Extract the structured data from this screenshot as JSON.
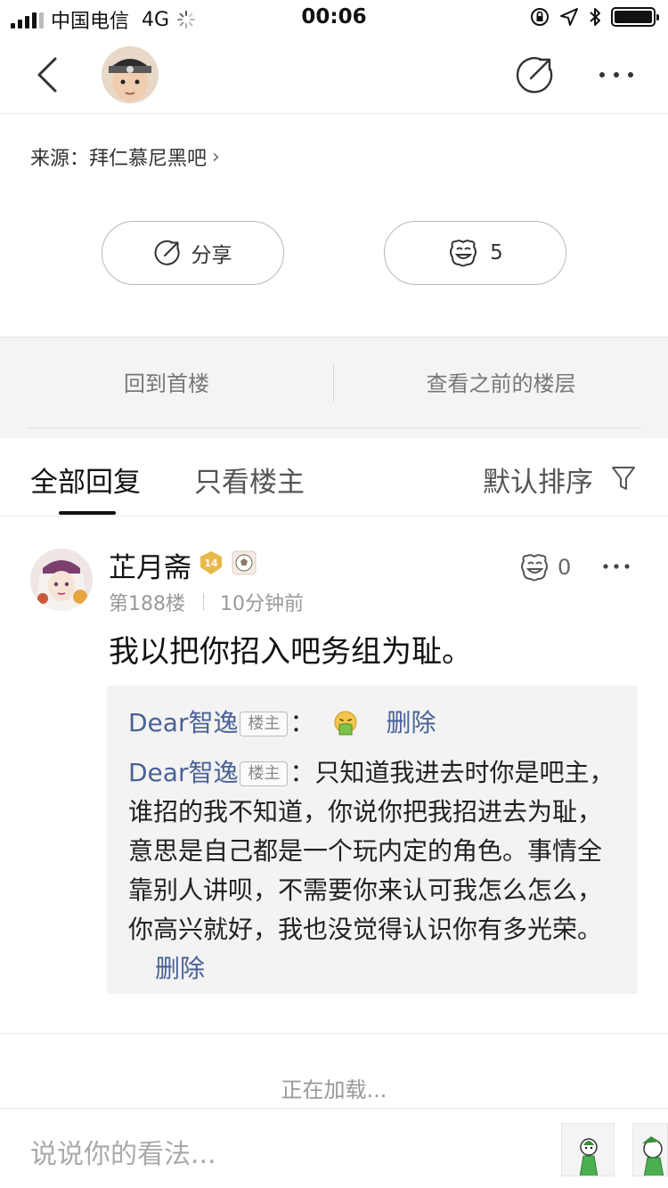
{
  "status_bar": {
    "carrier": "中国电信",
    "network": "4G",
    "time": "00:06"
  },
  "navbar": {
    "back_icon": "chevron-left-icon",
    "share_icon": "share-arrow-icon",
    "more_icon": "more-dots-icon"
  },
  "source": {
    "prefix": "来源：",
    "forum": "拜仁慕尼黑吧",
    "chevron": "›"
  },
  "actions": {
    "share_label": "分享",
    "like_count": "5"
  },
  "floor_nav": {
    "back_to_first": "回到首楼",
    "view_previous": "查看之前的楼层"
  },
  "tabs": {
    "all_replies": "全部回复",
    "author_only": "只看楼主",
    "sort_label": "默认排序"
  },
  "post": {
    "username": "芷月斋",
    "level": "14",
    "floor": "第188楼",
    "time_ago": "10分钟前",
    "like_count": "0",
    "content": "我以把你招入吧务组为耻。",
    "replies": [
      {
        "user": "Dear智逸",
        "tag": "楼主",
        "separator": "：",
        "text": "",
        "emoji": "vomit-emoji-icon",
        "delete": "删除"
      },
      {
        "user": "Dear智逸",
        "tag": "楼主",
        "separator": "：",
        "text": "只知道我进去时你是吧主，谁招的我不知道，你说你把我招进去为耻，意思是自己都是一个玩内定的角色。事情全靠别人讲呗，不需要你来认可我怎么怎么，你高兴就好，我也没觉得认识你有多光荣。",
        "delete": "删除"
      }
    ]
  },
  "loading_text": "正在加载...",
  "input": {
    "placeholder": "说说你的看法..."
  },
  "colors": {
    "link_blue": "#4a6296",
    "level_gold": "#e8b94a",
    "floor_bg": "#f4f4f4"
  }
}
